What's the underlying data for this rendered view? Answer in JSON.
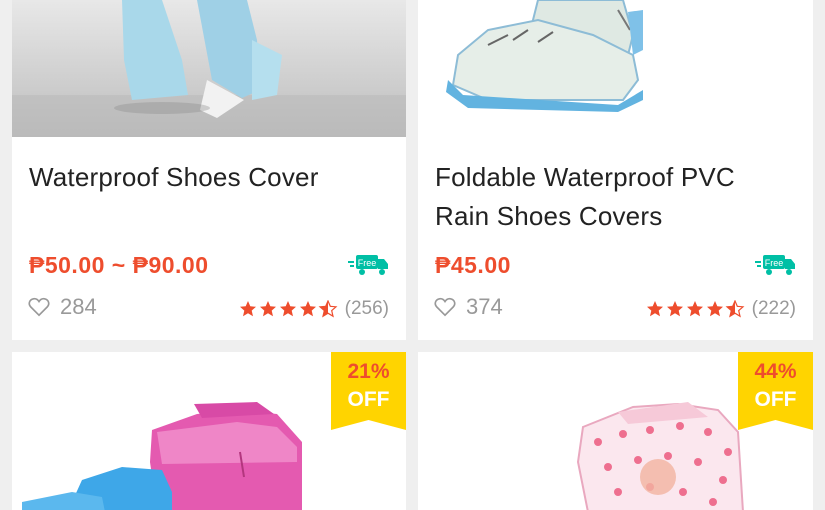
{
  "products": [
    {
      "title": "Waterproof Shoes Cover",
      "price": "₱50.00 ~ ₱90.00",
      "shipping_badge": "Free",
      "likes": "284",
      "rating_stars": 4.5,
      "rating_count": "(256)",
      "image_icon": "shoe-cover-photo"
    },
    {
      "title": "Foldable Waterproof PVC Rain Shoes Covers",
      "price": "₱45.00",
      "shipping_badge": "Free",
      "likes": "374",
      "rating_stars": 4.5,
      "rating_count": "(222)",
      "image_icon": "shoe-cover-photo"
    },
    {
      "discount_pct": "21%",
      "discount_label": "OFF",
      "image_icon": "rain-boot-cover-photo"
    },
    {
      "discount_pct": "44%",
      "discount_label": "OFF",
      "image_icon": "polka-dot-boot-cover-photo"
    }
  ],
  "colors": {
    "accent": "#ee4d2d",
    "badge_yellow": "#ffd400",
    "free_ship_teal": "#00bfa5",
    "star": "#ee4d2d",
    "muted": "#999999",
    "background": "#efefef"
  }
}
